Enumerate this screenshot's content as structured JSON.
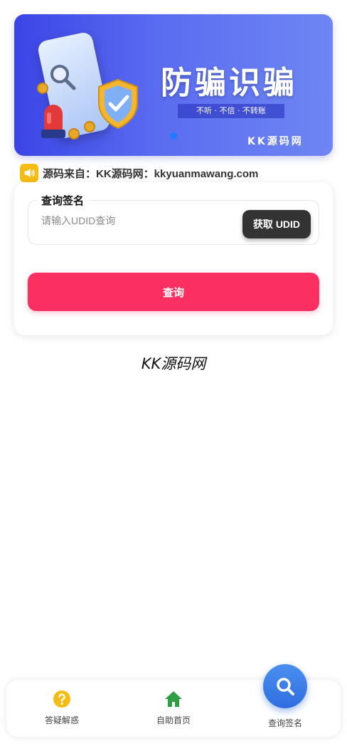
{
  "banner": {
    "headline": "防骗识骗",
    "subtitle": "不听 · 不信 · 不转账",
    "brand": "KK源码网"
  },
  "notice": {
    "text": "源码来自：KK源码网：kkyuanmawang.com",
    "icon": "speaker-icon"
  },
  "query_form": {
    "legend": "查询签名",
    "udid_placeholder": "请输入UDID查询",
    "udid_value": "",
    "get_udid_label": "获取 UDID",
    "submit_label": "查询"
  },
  "footer_brand": "KK源码网",
  "bottom_nav": {
    "items": [
      {
        "label": "答疑解惑",
        "icon": "question-icon",
        "color": "#f5bd13"
      },
      {
        "label": "自助首页",
        "icon": "home-icon",
        "color": "#2f9e44"
      },
      {
        "label": "查询签名",
        "icon": "search-icon",
        "color": "#2f6de0"
      }
    ]
  },
  "colors": {
    "accent": "#fc2f63",
    "dark_button": "#333333",
    "banner_start": "#3b45e6",
    "banner_end": "#6e86f3"
  }
}
